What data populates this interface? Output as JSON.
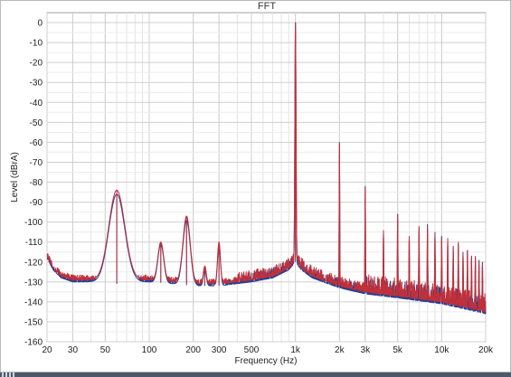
{
  "chart_data": {
    "type": "line",
    "title": "FFT",
    "xlabel": "Frequency (Hz)",
    "ylabel": "Level (dBrA)",
    "xscale": "log",
    "xlim": [
      20,
      20000
    ],
    "ylim": [
      -160,
      5
    ],
    "grid": true,
    "legend": "none",
    "x_ticks": [
      {
        "value": 20,
        "label": "20"
      },
      {
        "value": 30,
        "label": "30"
      },
      {
        "value": 50,
        "label": "50"
      },
      {
        "value": 100,
        "label": "100"
      },
      {
        "value": 200,
        "label": "200"
      },
      {
        "value": 300,
        "label": "300"
      },
      {
        "value": 500,
        "label": "500"
      },
      {
        "value": 1000,
        "label": "1k"
      },
      {
        "value": 2000,
        "label": "2k"
      },
      {
        "value": 3000,
        "label": "3k"
      },
      {
        "value": 5000,
        "label": "5k"
      },
      {
        "value": 10000,
        "label": "10k"
      },
      {
        "value": 20000,
        "label": "20k"
      }
    ],
    "y_ticks": [
      {
        "value": 0,
        "label": "0"
      },
      {
        "value": -10,
        "label": "-10"
      },
      {
        "value": -20,
        "label": "-20"
      },
      {
        "value": -30,
        "label": "-30"
      },
      {
        "value": -40,
        "label": "-40"
      },
      {
        "value": -50,
        "label": "-50"
      },
      {
        "value": -60,
        "label": "-60"
      },
      {
        "value": -70,
        "label": "-70"
      },
      {
        "value": -80,
        "label": "-80"
      },
      {
        "value": -90,
        "label": "-90"
      },
      {
        "value": -100,
        "label": "-100"
      },
      {
        "value": -110,
        "label": "-110"
      },
      {
        "value": -120,
        "label": "-120"
      },
      {
        "value": -130,
        "label": "-130"
      },
      {
        "value": -140,
        "label": "-140"
      },
      {
        "value": -150,
        "label": "-150"
      },
      {
        "value": -160,
        "label": "-160"
      }
    ],
    "series": [
      {
        "color": "#2b3f8f",
        "noise_floor": [
          [
            20,
            -118
          ],
          [
            22,
            -124
          ],
          [
            25,
            -128
          ],
          [
            30,
            -130
          ],
          [
            40,
            -130
          ],
          [
            50,
            -131
          ],
          [
            60,
            -131
          ],
          [
            80,
            -130
          ],
          [
            100,
            -130
          ],
          [
            150,
            -131
          ],
          [
            200,
            -132
          ],
          [
            300,
            -132
          ],
          [
            500,
            -130
          ],
          [
            700,
            -128
          ],
          [
            900,
            -124
          ],
          [
            1000,
            -120
          ],
          [
            1100,
            -124
          ],
          [
            1300,
            -128
          ],
          [
            2000,
            -133
          ],
          [
            3000,
            -136
          ],
          [
            5000,
            -138
          ],
          [
            10000,
            -141
          ],
          [
            20000,
            -146
          ]
        ],
        "peaks": [
          {
            "f": 60,
            "level": -86,
            "width": 0.055
          },
          {
            "f": 120,
            "level": -111,
            "width": 0.02
          },
          {
            "f": 180,
            "level": -99,
            "width": 0.025
          },
          {
            "f": 240,
            "level": -124,
            "width": 0.01
          },
          {
            "f": 300,
            "level": -111,
            "width": 0.01
          },
          {
            "f": 1000,
            "level": 0,
            "width": 0.004
          },
          {
            "f": 2000,
            "level": -60,
            "width": 0.002
          },
          {
            "f": 3000,
            "level": -82,
            "width": 0.002
          },
          {
            "f": 4000,
            "level": -106,
            "width": 0.002
          },
          {
            "f": 5000,
            "level": -96,
            "width": 0.002
          },
          {
            "f": 6000,
            "level": -108,
            "width": 0.002
          },
          {
            "f": 7000,
            "level": -103,
            "width": 0.002
          },
          {
            "f": 8000,
            "level": -101,
            "width": 0.002
          },
          {
            "f": 9000,
            "level": -105,
            "width": 0.002
          },
          {
            "f": 10000,
            "level": -107,
            "width": 0.002
          },
          {
            "f": 11000,
            "level": -110,
            "width": 0.002
          },
          {
            "f": 12000,
            "level": -112,
            "width": 0.002
          },
          {
            "f": 13000,
            "level": -111,
            "width": 0.002
          },
          {
            "f": 14000,
            "level": -115,
            "width": 0.002
          },
          {
            "f": 15000,
            "level": -114,
            "width": 0.002
          },
          {
            "f": 16000,
            "level": -117,
            "width": 0.002
          },
          {
            "f": 17000,
            "level": -118,
            "width": 0.002
          },
          {
            "f": 18000,
            "level": -119,
            "width": 0.002
          },
          {
            "f": 19000,
            "level": -120,
            "width": 0.002
          }
        ]
      },
      {
        "color": "#c0303a",
        "noise_floor": [
          [
            20,
            -117
          ],
          [
            22,
            -123
          ],
          [
            25,
            -127
          ],
          [
            30,
            -129
          ],
          [
            40,
            -129
          ],
          [
            50,
            -130
          ],
          [
            60,
            -130
          ],
          [
            80,
            -129
          ],
          [
            100,
            -129
          ],
          [
            150,
            -130
          ],
          [
            200,
            -131
          ],
          [
            300,
            -131
          ],
          [
            500,
            -129
          ],
          [
            700,
            -127
          ],
          [
            900,
            -123
          ],
          [
            1000,
            -119
          ],
          [
            1100,
            -123
          ],
          [
            1300,
            -127
          ],
          [
            2000,
            -132
          ],
          [
            3000,
            -135
          ],
          [
            5000,
            -137
          ],
          [
            10000,
            -140
          ],
          [
            20000,
            -145
          ]
        ],
        "peaks": [
          {
            "f": 60,
            "level": -84,
            "width": 0.055
          },
          {
            "f": 120,
            "level": -110,
            "width": 0.02
          },
          {
            "f": 180,
            "level": -97,
            "width": 0.025
          },
          {
            "f": 240,
            "level": -122,
            "width": 0.01
          },
          {
            "f": 300,
            "level": -110,
            "width": 0.01
          },
          {
            "f": 1000,
            "level": 0,
            "width": 0.004
          },
          {
            "f": 2000,
            "level": -61,
            "width": 0.002
          },
          {
            "f": 3000,
            "level": -83,
            "width": 0.002
          },
          {
            "f": 4000,
            "level": -104,
            "width": 0.002
          },
          {
            "f": 5000,
            "level": -96,
            "width": 0.002
          },
          {
            "f": 6000,
            "level": -107,
            "width": 0.002
          },
          {
            "f": 7000,
            "level": -102,
            "width": 0.002
          },
          {
            "f": 8000,
            "level": -103,
            "width": 0.002
          },
          {
            "f": 9000,
            "level": -106,
            "width": 0.002
          },
          {
            "f": 10000,
            "level": -108,
            "width": 0.002
          },
          {
            "f": 11000,
            "level": -108,
            "width": 0.002
          },
          {
            "f": 12000,
            "level": -113,
            "width": 0.002
          },
          {
            "f": 13000,
            "level": -110,
            "width": 0.002
          },
          {
            "f": 14000,
            "level": -116,
            "width": 0.002
          },
          {
            "f": 15000,
            "level": -114,
            "width": 0.002
          },
          {
            "f": 16000,
            "level": -118,
            "width": 0.002
          },
          {
            "f": 17000,
            "level": -117,
            "width": 0.002
          },
          {
            "f": 18000,
            "level": -120,
            "width": 0.002
          },
          {
            "f": 19000,
            "level": -121,
            "width": 0.002
          }
        ]
      }
    ]
  }
}
